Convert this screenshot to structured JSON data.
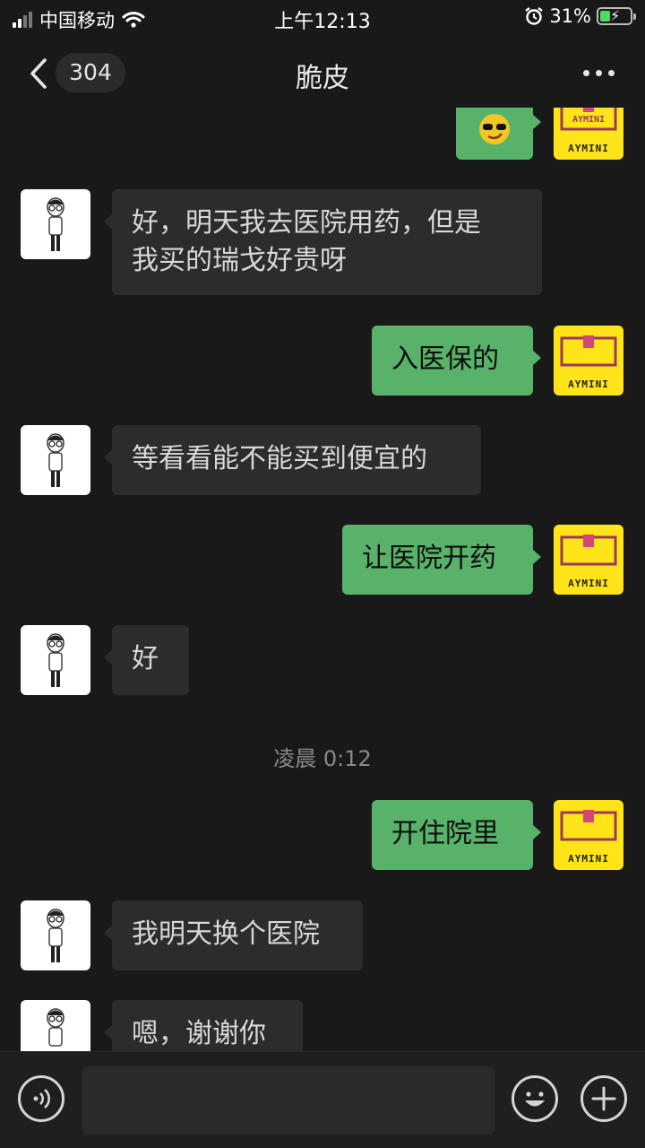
{
  "status_bar": {
    "carrier": "中国移动",
    "time": "上午12:13",
    "battery_percent": "31%"
  },
  "nav": {
    "unread_count": "304",
    "title": "脆皮"
  },
  "self_avatar_brand": "AYMINI",
  "messages": [
    {
      "from": "friend",
      "text_lines": [
        "好，明天我去医院用药，但是",
        "我买的瑞戈好贵呀"
      ]
    },
    {
      "from": "me",
      "text": "入医保的"
    },
    {
      "from": "friend",
      "text": "等看看能不能买到便宜的"
    },
    {
      "from": "me",
      "text": "让医院开药"
    },
    {
      "from": "friend",
      "text": "好"
    },
    {
      "type": "time",
      "text": "凌晨 0:12"
    },
    {
      "from": "me",
      "text": "开住院里"
    },
    {
      "from": "friend",
      "text": "我明天换个医院"
    },
    {
      "from": "friend",
      "text": "嗯，谢谢你"
    }
  ],
  "colors": {
    "background": "#191919",
    "incoming_bubble": "#2c2c2c",
    "outgoing_bubble": "#59b269",
    "self_avatar": "#ffe419"
  },
  "icons": [
    "signal-icon",
    "wifi-icon",
    "alarm-icon",
    "battery-icon",
    "back-icon",
    "more-icon",
    "sunglasses-emoji-icon",
    "voice-icon",
    "emoji-icon",
    "plus-icon"
  ]
}
